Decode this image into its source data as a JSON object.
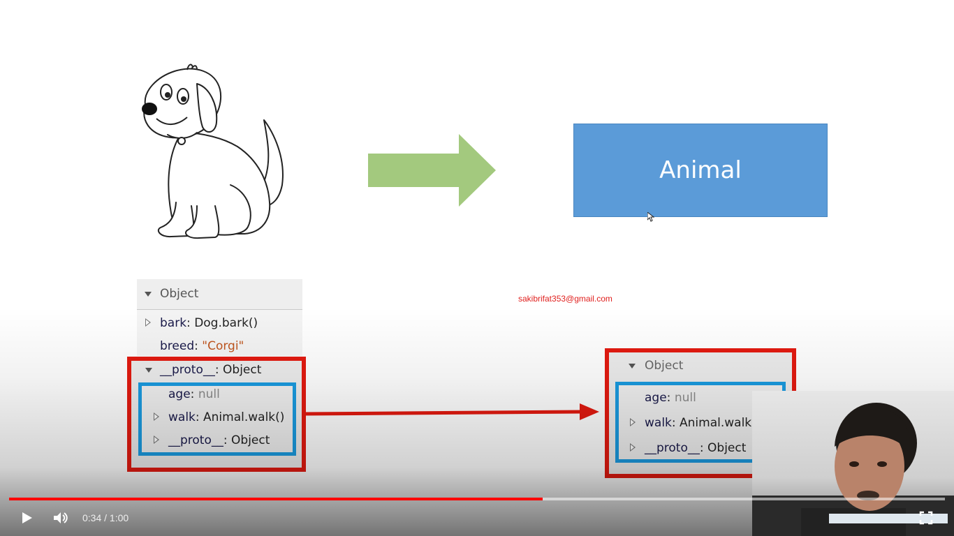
{
  "slide": {
    "target_label": "Animal",
    "email": "sakibrifat353@gmail.com"
  },
  "left_object": {
    "header": "Object",
    "rows": [
      {
        "key": "bark",
        "sep": ": ",
        "value": "Dog.bark()"
      },
      {
        "key": "breed",
        "sep": ": ",
        "value": "\"Corgi\""
      },
      {
        "key": "__proto__",
        "sep": ": ",
        "value": "Object"
      },
      {
        "key": "age",
        "sep": ": ",
        "value": "null"
      },
      {
        "key": "walk",
        "sep": ": ",
        "value": "Animal.walk()"
      },
      {
        "key": "__proto__",
        "sep": ": ",
        "value": "Object"
      }
    ]
  },
  "right_object": {
    "header": "Object",
    "rows": [
      {
        "key": "age",
        "sep": ": ",
        "value": "null"
      },
      {
        "key": "walk",
        "sep": ": ",
        "value": "Animal.walk()"
      },
      {
        "key": "__proto__",
        "sep": ": ",
        "value": "Object"
      }
    ]
  },
  "player": {
    "time": "0:34 / 1:00",
    "progress": 0.57,
    "progress_color": "#ff0000"
  },
  "colors": {
    "box_blue": "#5b9bd8",
    "arrow_green": "#a3c97e",
    "highlight_red": "#e31a10",
    "highlight_blue": "#1a9be0"
  },
  "icons": {
    "play": "play-icon",
    "volume": "volume-icon",
    "fullscreen": "fullscreen-icon"
  }
}
